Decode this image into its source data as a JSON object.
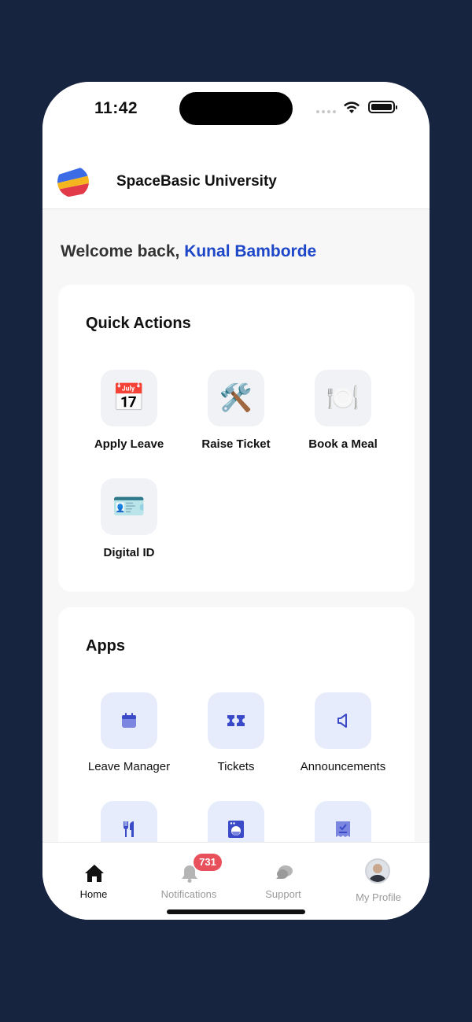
{
  "status_bar": {
    "time": "11:42"
  },
  "header": {
    "org_name": "SpaceBasic University",
    "logo_icon": "spacebasic-logo"
  },
  "welcome": {
    "prefix": "Welcome back, ",
    "user_name": "Kunal Bamborde"
  },
  "quick_actions": {
    "title": "Quick Actions",
    "items": [
      {
        "label": "Apply Leave",
        "icon": "calendar-icon",
        "glyph": "📅"
      },
      {
        "label": "Raise Ticket",
        "icon": "tools-icon",
        "glyph": "🛠️"
      },
      {
        "label": "Book a Meal",
        "icon": "plate-icon",
        "glyph": "🍽️"
      },
      {
        "label": "Digital ID",
        "icon": "id-card-icon",
        "glyph": "🪪"
      }
    ]
  },
  "apps": {
    "title": "Apps",
    "items": [
      {
        "label": "Leave Manager",
        "icon": "calendar-icon"
      },
      {
        "label": "Tickets",
        "icon": "ticket-icon"
      },
      {
        "label": "Announcements",
        "icon": "megaphone-icon"
      },
      {
        "label": "",
        "icon": "fork-knife-icon"
      },
      {
        "label": "",
        "icon": "washing-machine-icon"
      },
      {
        "label": "",
        "icon": "receipt-icon"
      }
    ]
  },
  "bottom_nav": {
    "items": [
      {
        "label": "Home",
        "icon": "home-icon",
        "active": true
      },
      {
        "label": "Notifications",
        "icon": "bell-icon",
        "badge": "731"
      },
      {
        "label": "Support",
        "icon": "chat-bubbles-icon"
      },
      {
        "label": "My Profile",
        "icon": "avatar"
      }
    ]
  },
  "colors": {
    "background": "#172440",
    "accent": "#1d47c8",
    "app_icon_bg": "#e6ecfb",
    "app_icon_fg": "#3b4bc8",
    "badge": "#e8505b"
  }
}
